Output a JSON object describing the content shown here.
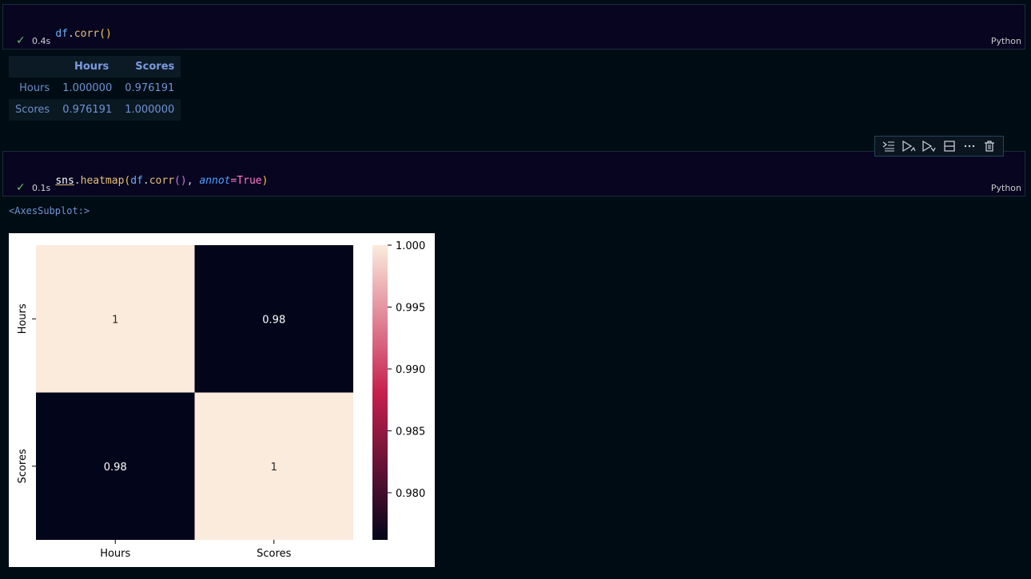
{
  "cell1": {
    "code": {
      "obj": "df",
      "dot": ".",
      "fn": "corr",
      "open": "(",
      "close": ")"
    },
    "status": {
      "check": "✓",
      "time": "0.4s"
    },
    "language": "Python"
  },
  "dataframe": {
    "columns": [
      "",
      "Hours",
      "Scores"
    ],
    "rows": [
      {
        "index": "Hours",
        "values": [
          "1.000000",
          "0.976191"
        ]
      },
      {
        "index": "Scores",
        "values": [
          "0.976191",
          "1.000000"
        ]
      }
    ]
  },
  "cell_toolbar": {
    "icons": [
      "run-by-line-icon",
      "execute-above-icon",
      "execute-below-icon",
      "split-cell-icon",
      "more-icon",
      "delete-icon"
    ]
  },
  "cell2": {
    "code": {
      "sns": "sns",
      "dot1": ".",
      "fn": "heatmap",
      "open": "(",
      "obj": "df",
      "dot2": ".",
      "fn2": "corr",
      "inner": "()",
      "comma": ", ",
      "kw": "annot",
      "eq": "=",
      "val": "True",
      "close": ")"
    },
    "status": {
      "check": "✓",
      "time": "0.1s"
    },
    "language": "Python"
  },
  "output_repr": "<AxesSubplot:>",
  "chart_data": {
    "type": "heatmap",
    "x_labels": [
      "Hours",
      "Scores"
    ],
    "y_labels": [
      "Hours",
      "Scores"
    ],
    "values": [
      [
        1.0,
        0.976191
      ],
      [
        0.976191,
        1.0
      ]
    ],
    "annotations": [
      [
        "1",
        "0.98"
      ],
      [
        "0.98",
        "1"
      ]
    ],
    "colorbar": {
      "range": [
        0.976191,
        1.0
      ],
      "ticks": [
        1.0,
        0.995,
        0.99,
        0.985,
        0.98
      ],
      "tick_labels": [
        "1.000",
        "0.995",
        "0.990",
        "0.985",
        "0.980"
      ]
    },
    "colors": {
      "low": "#03051a",
      "mid": "#c6204e",
      "high": "#faebdd"
    }
  }
}
